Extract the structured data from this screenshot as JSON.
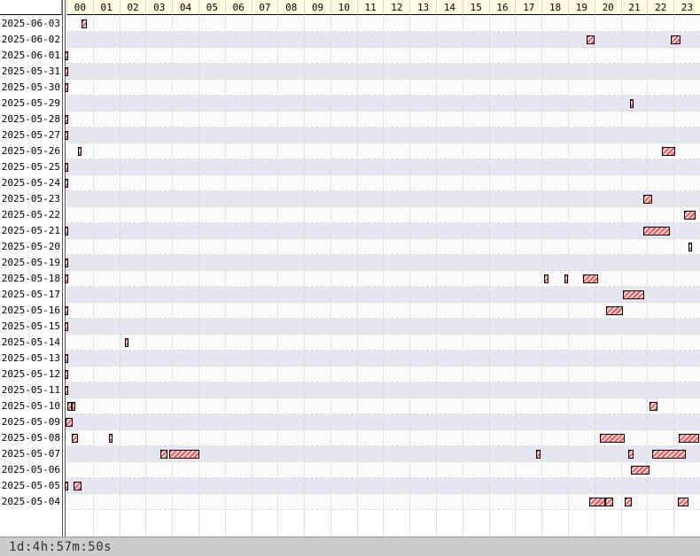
{
  "hours": [
    "00",
    "01",
    "02",
    "03",
    "04",
    "05",
    "06",
    "07",
    "08",
    "09",
    "10",
    "11",
    "12",
    "13",
    "14",
    "15",
    "16",
    "17",
    "18",
    "19",
    "20",
    "21",
    "22",
    "23"
  ],
  "rows": [
    {
      "date": "2025-06-03",
      "bars": [
        [
          0.58,
          0.78
        ]
      ]
    },
    {
      "date": "2025-06-02",
      "bars": [
        [
          19.7,
          20.0
        ],
        [
          22.9,
          23.25
        ]
      ]
    },
    {
      "date": "2025-06-01",
      "bars": [
        [
          -0.08,
          0.05
        ]
      ]
    },
    {
      "date": "2025-05-31",
      "bars": [
        [
          -0.08,
          0.05
        ]
      ]
    },
    {
      "date": "2025-05-30",
      "bars": [
        [
          -0.08,
          0.05
        ]
      ]
    },
    {
      "date": "2025-05-29",
      "bars": [
        [
          21.35,
          21.45
        ]
      ]
    },
    {
      "date": "2025-05-28",
      "bars": [
        [
          -0.08,
          0.05
        ]
      ]
    },
    {
      "date": "2025-05-27",
      "bars": [
        [
          -0.08,
          0.05
        ]
      ]
    },
    {
      "date": "2025-05-26",
      "bars": [
        [
          0.42,
          0.52
        ],
        [
          22.55,
          23.05
        ]
      ]
    },
    {
      "date": "2025-05-25",
      "bars": [
        [
          -0.08,
          0.05
        ]
      ]
    },
    {
      "date": "2025-05-24",
      "bars": [
        [
          -0.08,
          0.05
        ]
      ]
    },
    {
      "date": "2025-05-23",
      "bars": [
        [
          21.85,
          22.2
        ]
      ]
    },
    {
      "date": "2025-05-22",
      "bars": [
        [
          23.4,
          23.85
        ]
      ]
    },
    {
      "date": "2025-05-21",
      "bars": [
        [
          -0.08,
          0.05
        ],
        [
          21.85,
          22.85
        ]
      ]
    },
    {
      "date": "2025-05-20",
      "bars": [
        [
          23.55,
          23.7
        ]
      ]
    },
    {
      "date": "2025-05-19",
      "bars": [
        [
          -0.08,
          0.05
        ]
      ]
    },
    {
      "date": "2025-05-18",
      "bars": [
        [
          -0.08,
          0.05
        ],
        [
          18.1,
          18.25
        ],
        [
          18.85,
          18.98
        ],
        [
          19.58,
          20.15
        ]
      ]
    },
    {
      "date": "2025-05-17",
      "bars": [
        [
          21.08,
          21.88
        ]
      ]
    },
    {
      "date": "2025-05-16",
      "bars": [
        [
          -0.08,
          0.05
        ],
        [
          20.45,
          21.08
        ]
      ]
    },
    {
      "date": "2025-05-15",
      "bars": [
        [
          -0.08,
          0.05
        ]
      ]
    },
    {
      "date": "2025-05-14",
      "bars": [
        [
          2.22,
          2.32
        ]
      ]
    },
    {
      "date": "2025-05-13",
      "bars": [
        [
          -0.08,
          0.05
        ]
      ]
    },
    {
      "date": "2025-05-12",
      "bars": [
        [
          -0.08,
          0.05
        ]
      ]
    },
    {
      "date": "2025-05-11",
      "bars": [
        [
          -0.08,
          0.05
        ]
      ]
    },
    {
      "date": "2025-05-10",
      "bars": [
        [
          0.03,
          0.2
        ],
        [
          0.2,
          0.28
        ],
        [
          22.08,
          22.38
        ]
      ]
    },
    {
      "date": "2025-05-09",
      "bars": [
        [
          -0.05,
          0.25
        ]
      ]
    },
    {
      "date": "2025-05-08",
      "bars": [
        [
          0.2,
          0.45
        ],
        [
          1.6,
          1.7
        ],
        [
          20.2,
          21.15
        ],
        [
          23.2,
          23.98
        ]
      ]
    },
    {
      "date": "2025-05-07",
      "bars": [
        [
          3.55,
          3.82
        ],
        [
          3.88,
          5.02
        ],
        [
          17.8,
          17.95
        ],
        [
          21.28,
          21.5
        ],
        [
          22.2,
          23.48
        ]
      ]
    },
    {
      "date": "2025-05-06",
      "bars": [
        [
          21.38,
          22.1
        ]
      ]
    },
    {
      "date": "2025-05-05",
      "bars": [
        [
          -0.08,
          0.05
        ],
        [
          0.27,
          0.58
        ]
      ]
    },
    {
      "date": "2025-05-04",
      "bars": [
        [
          19.8,
          20.4
        ],
        [
          20.4,
          20.72
        ],
        [
          21.15,
          21.42
        ],
        [
          23.15,
          23.55
        ]
      ]
    }
  ],
  "footer": {
    "elapsed": "1d:4h:57m:50s"
  }
}
